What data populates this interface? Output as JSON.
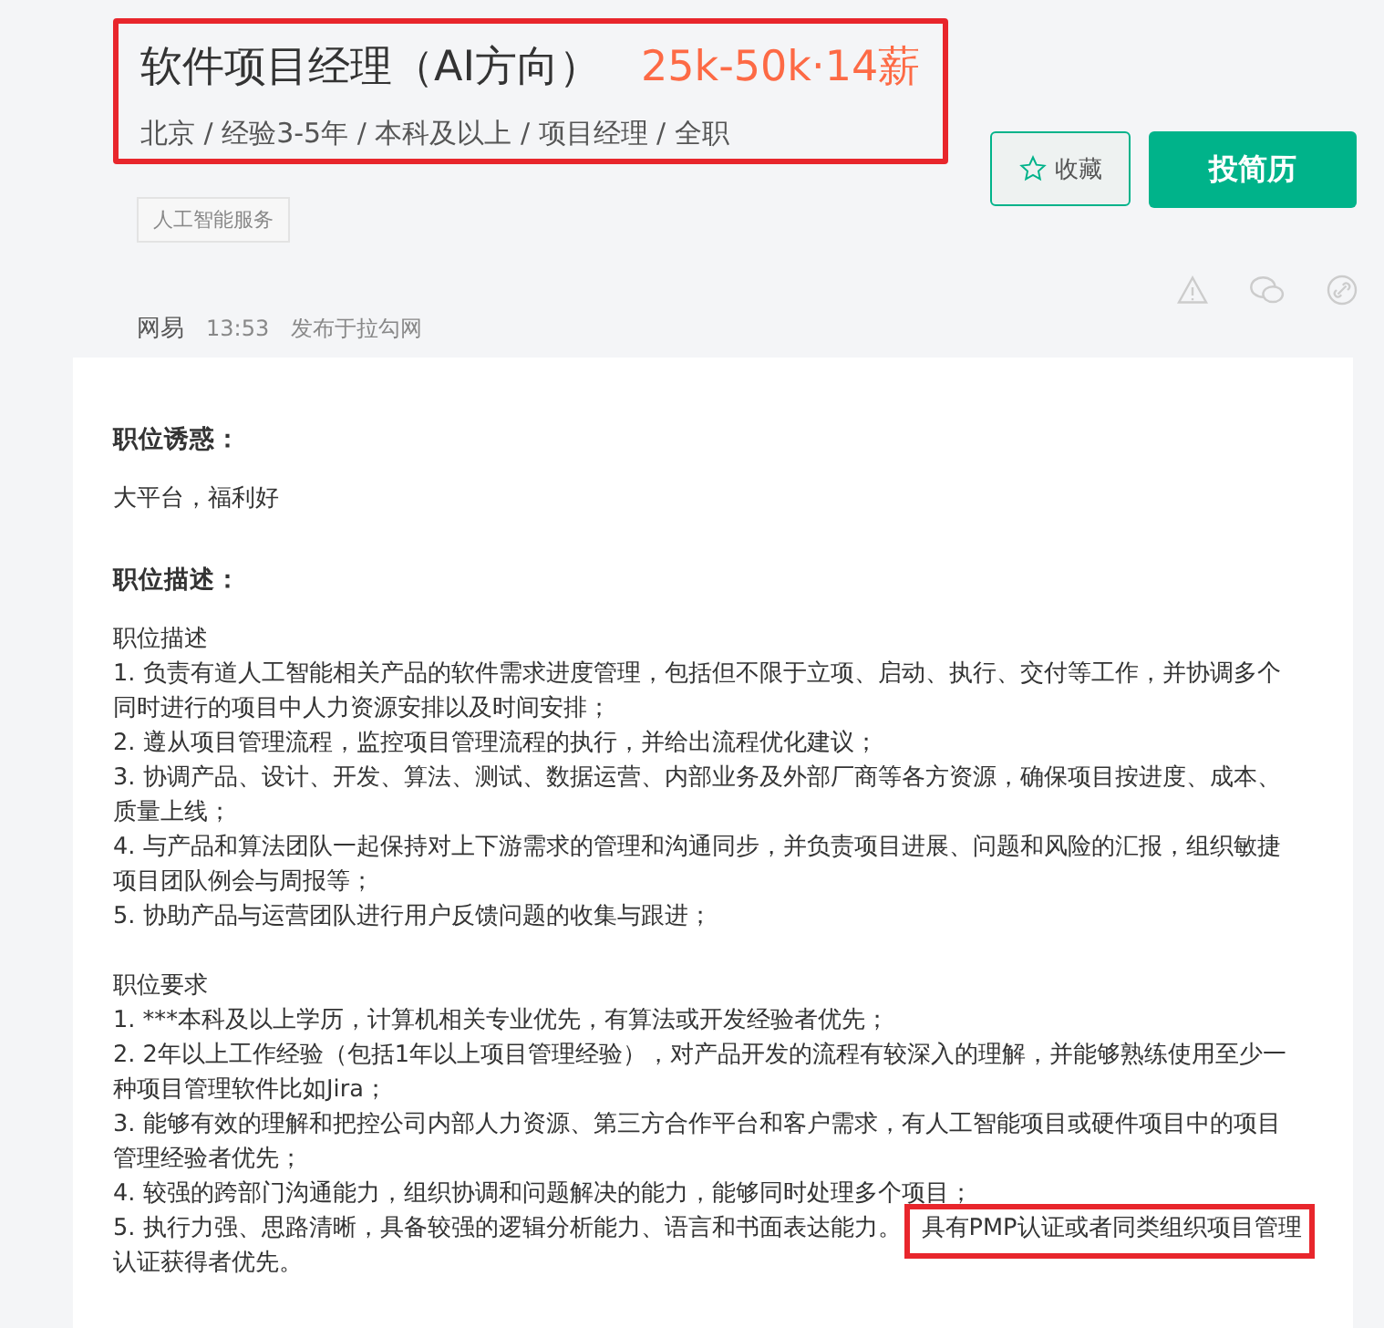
{
  "header": {
    "highlighted": true,
    "title": "软件项目经理（AI方向）",
    "salary": "25k-50k·14薪",
    "meta": "北京 / 经验3-5年 / 本科及以上 / 项目经理 / 全职",
    "tags": [
      "人工智能服务"
    ],
    "collect_button": "收藏",
    "apply_button": "投简历",
    "company": "网易",
    "time": "13:53",
    "source": "发布于拉勾网"
  },
  "sections": [
    {
      "heading": "职位诱惑：",
      "blocks": [
        {
          "items": [
            {
              "lines": [
                "大平台，福利好"
              ]
            }
          ]
        }
      ]
    },
    {
      "heading": "职位描述：",
      "blocks": [
        {
          "title": "职位描述",
          "items": [
            {
              "lines": [
                "1. 负责有道人工智能相关产品的软件需求进度管理，包括但不限于立项、启动、执行、交付等工作，并协调多个",
                "同时进行的项目中人力资源安排以及时间安排；"
              ]
            },
            {
              "lines": [
                "2. 遵从项目管理流程，监控项目管理流程的执行，并给出流程优化建议；"
              ]
            },
            {
              "lines": [
                "3. 协调产品、设计、开发、算法、测试、数据运营、内部业务及外部厂商等各方资源，确保项目按进度、成本、",
                "质量上线；"
              ]
            },
            {
              "lines": [
                "4. 与产品和算法团队一起保持对上下游需求的管理和沟通同步，并负责项目进展、问题和风险的汇报，组织敏捷",
                "项目团队例会与周报等；"
              ]
            },
            {
              "lines": [
                "5. 协助产品与运营团队进行用户反馈问题的收集与跟进；"
              ]
            }
          ]
        },
        {
          "title": "职位要求",
          "items": [
            {
              "lines": [
                "1. ***本科及以上学历，计算机相关专业优先，有算法或开发经验者优先；"
              ]
            },
            {
              "lines": [
                "2. 2年以上工作经验（包括1年以上项目管理经验），对产品开发的流程有较深入的理解，并能够熟练使用至少一",
                "种项目管理软件比如Jira；"
              ]
            },
            {
              "lines": [
                "3. 能够有效的理解和把控公司内部人力资源、第三方合作平台和客户需求，有人工智能项目或硬件项目中的项目",
                "管理经验者优先；"
              ]
            },
            {
              "lines": [
                "4. 较强的跨部门沟通能力，组织协调和问题解决的能力，能够同时处理多个项目；"
              ]
            },
            {
              "lines": [
                "5. 执行力强、思路清晰，具备较强的逻辑分析能力、语言和书面表达能力。",
                "认证获得者优先。"
              ],
              "highlighted": "具有PMP认证或者同类组织项目管理"
            }
          ]
        }
      ]
    }
  ]
}
